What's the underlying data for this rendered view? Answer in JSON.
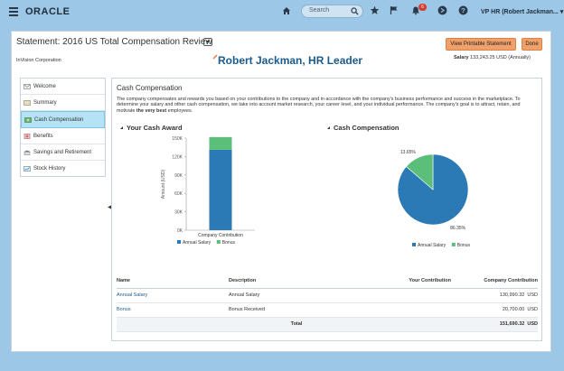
{
  "topbar": {
    "brand": "ORACLE",
    "search_placeholder": "Search",
    "notification_count": "6",
    "user_menu": "VP HR (Robert Jackman... ▾"
  },
  "header": {
    "title": "Statement: 2016 US Total Compensation Review",
    "view_button": "View Printable Statement",
    "done_button": "Done",
    "company": "InVision Corporation",
    "employee": "Robert Jackman, HR Leader",
    "salary_label": "Salary",
    "salary_value": "133,243.25 USD (Annually)"
  },
  "nav": {
    "items": [
      {
        "label": "Welcome",
        "icon": "welcome-icon"
      },
      {
        "label": "Summary",
        "icon": "summary-icon"
      },
      {
        "label": "Cash Compensation",
        "icon": "cash-icon",
        "active": true
      },
      {
        "label": "Benefits",
        "icon": "benefits-icon"
      },
      {
        "label": "Savings and Retirement",
        "icon": "savings-icon"
      },
      {
        "label": "Stock History",
        "icon": "stock-icon"
      }
    ]
  },
  "content": {
    "title": "Cash Compensation",
    "intro_a": "The company compensates and rewards you based on your contributions to the company and in accordance with the company's business performance and success in the marketplace. To determine your salary and other cash compensation, we take into account market research, your career level, and your individual performance.  The company's goal is to attract, retain, and motivate ",
    "intro_b": "the very best",
    "intro_c": " employees.",
    "award_heading": "Your Cash Award",
    "cash_heading": "Cash Compensation"
  },
  "chart_data": [
    {
      "type": "bar",
      "stacked": true,
      "categories": [
        "Company Contribution"
      ],
      "series": [
        {
          "name": "Annual Salary",
          "values": [
            130990.32
          ],
          "color": "#2b79b5"
        },
        {
          "name": "Bonus",
          "values": [
            20700.0
          ],
          "color": "#5cbf79"
        }
      ],
      "ylabel": "Amount (USD)",
      "ylim": [
        0,
        150000
      ],
      "yticks": [
        "0K",
        "30K",
        "60K",
        "90K",
        "120K",
        "150K"
      ],
      "legend": "bottom"
    },
    {
      "type": "pie",
      "slices": [
        {
          "name": "Annual Salary",
          "value": 86.35,
          "label": "86.35%",
          "color": "#2b79b5"
        },
        {
          "name": "Bonus",
          "value": 13.65,
          "label": "13.65%",
          "color": "#5cbf79"
        }
      ],
      "legend": "bottom"
    }
  ],
  "table": {
    "headers": [
      "Name",
      "Description",
      "Your Contribution",
      "Company Contribution"
    ],
    "rows": [
      {
        "name": "Annual Salary",
        "description": "Annual Salary",
        "your": "",
        "company": "130,990.32",
        "currency": "USD"
      },
      {
        "name": "Bonus",
        "description": "Bonus Received",
        "your": "",
        "company": "20,700.00",
        "currency": "USD"
      }
    ],
    "total_label": "Total",
    "total_value": "151,690.32",
    "total_currency": "USD"
  }
}
